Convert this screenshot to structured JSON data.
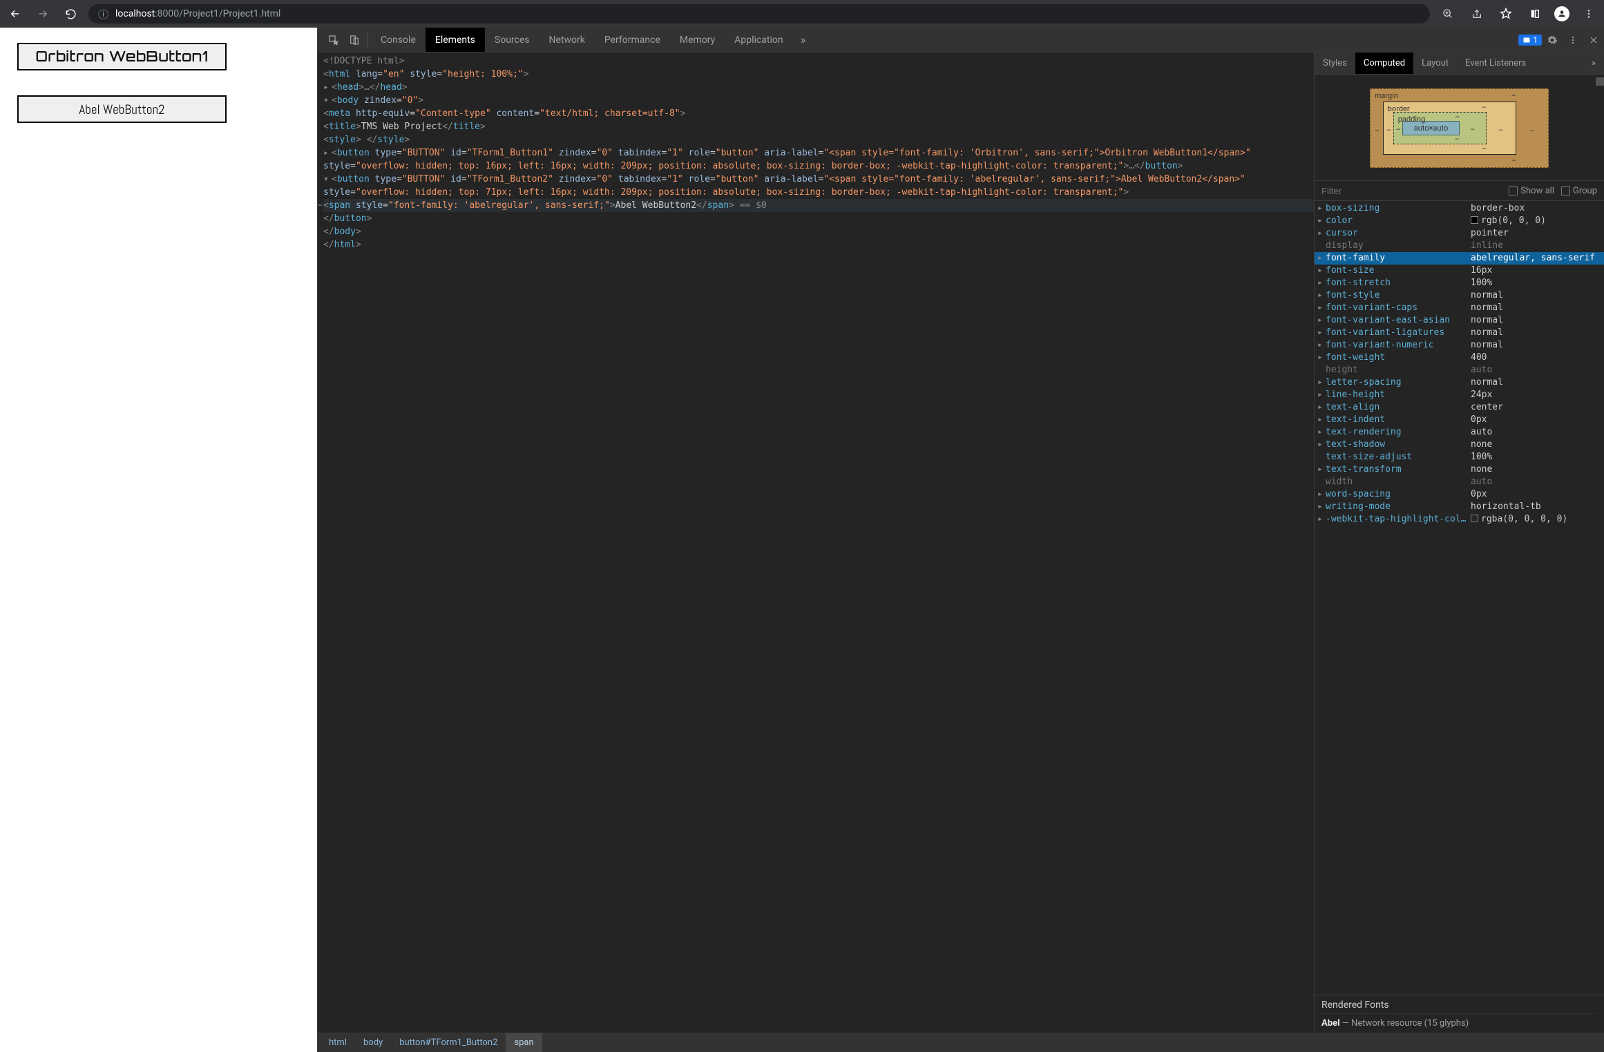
{
  "toolbar": {
    "url_host": "localhost",
    "url_port": ":8000",
    "url_path": "/Project1/Project1.html"
  },
  "page": {
    "button1_label": "Orbitron WebButton1",
    "button2_label": "Abel WebButton2"
  },
  "devtools": {
    "tabs": [
      "Console",
      "Elements",
      "Sources",
      "Network",
      "Performance",
      "Memory",
      "Application"
    ],
    "active_tab": "Elements",
    "issues_count": "1",
    "breadcrumb": [
      "html",
      "body",
      "button#TForm1_Button2",
      "span"
    ]
  },
  "elements": {
    "doctype": "<!DOCTYPE html>",
    "html_open": "html",
    "html_attrs": "lang=\"en\" style=\"height: 100%;\"",
    "head": "head",
    "body_open": "body",
    "body_attrs": "zindex=\"0\"",
    "meta_line": "<meta http-equiv=\"Content-type\" content=\"text/html; charset=utf-8\">",
    "title_text": "TMS Web Project",
    "style_tag": "<style> </style>",
    "btn1_open": "<button type=\"BUTTON\" id=\"TForm1_Button1\" zindex=\"0\" tabindex=\"1\" role=\"button\" aria-label=\"<span style=\"font-family: 'Orbitron', sans-serif;\">Orbitron WebButton1</span>\" style=\"overflow: hidden; top: 16px; left: 16px; width: 209px; position: absolute; box-sizing: border-box; -webkit-tap-highlight-color: transparent;\">…",
    "btn1_close": "</button>",
    "btn2_open": "<button type=\"BUTTON\" id=\"TForm1_Button2\" zindex=\"0\" tabindex=\"1\" role=\"button\" aria-label=\"<span style=\"font-family: 'abelregular', sans-serif;\">Abel WebButton2</span>\" style=\"overflow: hidden; top: 71px; left: 16px; width: 209px; position: absolute; box-sizing: border-box; -webkit-tap-highlight-color: transparent;\">",
    "span_line_pre": "<span style=\"font-family: 'abelregular', sans-serif;\">",
    "span_text": "Abel WebButton2",
    "span_close": "</span>",
    "eq_hint": " == $0",
    "btn2_close": "</button>",
    "body_close": "</body>",
    "html_close": "</html>"
  },
  "sidebar": {
    "tabs": [
      "Styles",
      "Computed",
      "Layout",
      "Event Listeners"
    ],
    "active_tab": "Computed",
    "filter_placeholder": "Filter",
    "show_all": "Show all",
    "group": "Group",
    "box": {
      "margin": "margin",
      "border": "border",
      "padding": "padding",
      "content": "auto×auto",
      "dash": "–"
    }
  },
  "computed": [
    {
      "name": "box-sizing",
      "value": "border-box",
      "tw": "▸"
    },
    {
      "name": "color",
      "value": "rgb(0, 0, 0)",
      "tw": "▸",
      "swatch": "#000"
    },
    {
      "name": "cursor",
      "value": "pointer",
      "tw": "▸"
    },
    {
      "name": "display",
      "value": "inline",
      "dim": true
    },
    {
      "name": "font-family",
      "value": "abelregular, sans-serif",
      "tw": "▸",
      "highlight": true
    },
    {
      "name": "font-size",
      "value": "16px",
      "tw": "▸"
    },
    {
      "name": "font-stretch",
      "value": "100%",
      "tw": "▸"
    },
    {
      "name": "font-style",
      "value": "normal",
      "tw": "▸"
    },
    {
      "name": "font-variant-caps",
      "value": "normal",
      "tw": "▸"
    },
    {
      "name": "font-variant-east-asian",
      "value": "normal",
      "tw": "▸"
    },
    {
      "name": "font-variant-ligatures",
      "value": "normal",
      "tw": "▸"
    },
    {
      "name": "font-variant-numeric",
      "value": "normal",
      "tw": "▸"
    },
    {
      "name": "font-weight",
      "value": "400",
      "tw": "▸"
    },
    {
      "name": "height",
      "value": "auto",
      "dim": true
    },
    {
      "name": "letter-spacing",
      "value": "normal",
      "tw": "▸"
    },
    {
      "name": "line-height",
      "value": "24px",
      "tw": "▸"
    },
    {
      "name": "text-align",
      "value": "center",
      "tw": "▸"
    },
    {
      "name": "text-indent",
      "value": "0px",
      "tw": "▸"
    },
    {
      "name": "text-rendering",
      "value": "auto",
      "tw": "▸"
    },
    {
      "name": "text-shadow",
      "value": "none",
      "tw": "▸"
    },
    {
      "name": "text-size-adjust",
      "value": "100%"
    },
    {
      "name": "text-transform",
      "value": "none",
      "tw": "▸"
    },
    {
      "name": "width",
      "value": "auto",
      "dim": true
    },
    {
      "name": "word-spacing",
      "value": "0px",
      "tw": "▸"
    },
    {
      "name": "writing-mode",
      "value": "horizontal-tb",
      "tw": "▸"
    },
    {
      "name": "-webkit-tap-highlight-col…",
      "value": "rgba(0, 0, 0, 0)",
      "tw": "▸",
      "swatch": "rgba(0,0,0,0)"
    }
  ],
  "rendered_fonts": {
    "title": "Rendered Fonts",
    "family": "Abel",
    "meta": " — Network resource (15 glyphs)"
  }
}
